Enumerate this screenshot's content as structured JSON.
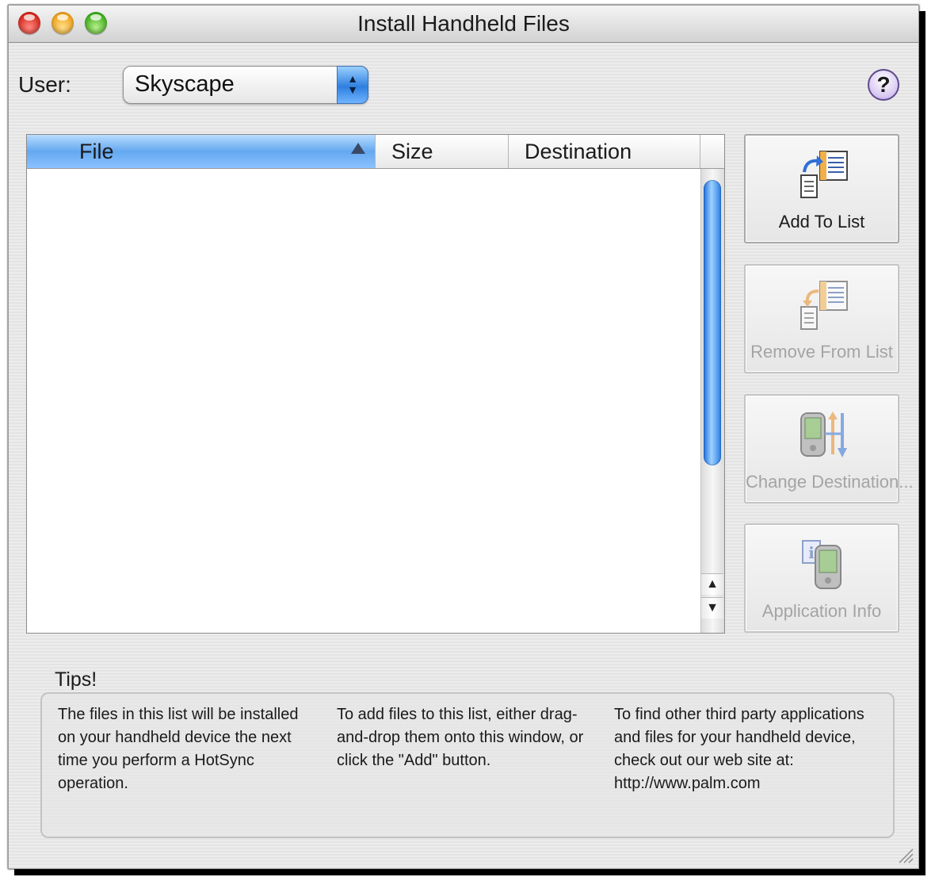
{
  "window": {
    "title": "Install Handheld Files"
  },
  "user": {
    "label": "User:",
    "selected": "Skyscape"
  },
  "help": {
    "label": "?"
  },
  "file_list": {
    "columns": [
      "File",
      "Size",
      "Destination"
    ],
    "sorted_by": "File",
    "rows": []
  },
  "actions": {
    "add": "Add To List",
    "remove": "Remove From List",
    "change": "Change Destination...",
    "info": "Application Info"
  },
  "tips": {
    "title": "Tips!",
    "items": [
      "The files in this list will be installed on your handheld device the next time you perform a HotSync operation.",
      "To add files to this list, either drag-and-drop them onto this window, or click the \"Add\" button.",
      "To find other third party applications and files for your handheld device, check out our web site at: http://www.palm.com"
    ]
  },
  "colors": {
    "selected_header": "#64a8f0",
    "scroll_thumb": "#2c7ce4",
    "disabled_text": "#a4a4a4"
  }
}
